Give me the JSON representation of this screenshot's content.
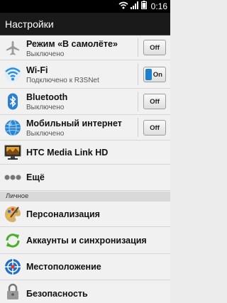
{
  "status_bar": {
    "time": "0:16",
    "icons": [
      "wifi-icon",
      "signal-icon",
      "battery-icon"
    ]
  },
  "title": "Настройки",
  "items": [
    {
      "title": "Режим «В самолёте»",
      "subtitle": "Выключено",
      "toggle": "Off",
      "icon": "airplane-icon"
    },
    {
      "title": "Wi-Fi",
      "subtitle": "Подключено к R3SNet",
      "toggle": "On",
      "icon": "wifi-icon"
    },
    {
      "title": "Bluetooth",
      "subtitle": "Выключено",
      "toggle": "Off",
      "icon": "bluetooth-icon"
    },
    {
      "title": "Мобильный интернет",
      "subtitle": "Выключено",
      "toggle": "Off",
      "icon": "globe-icon"
    },
    {
      "title": "HTC Media Link HD",
      "icon": "tv-icon"
    },
    {
      "title": "Ещё",
      "icon": "more-icon"
    }
  ],
  "section_label": "Личное",
  "personal_items": [
    {
      "title": "Персонализация",
      "icon": "palette-icon"
    },
    {
      "title": "Аккаунты и синхронизация",
      "icon": "sync-icon"
    },
    {
      "title": "Местоположение",
      "icon": "location-icon"
    },
    {
      "title": "Безопасность",
      "icon": "lock-icon"
    }
  ],
  "colors": {
    "accent": "#1d7fd0",
    "title_bar": "#1a1a1a",
    "status_bar": "#000000",
    "list_bg": "#f1f1f1"
  }
}
